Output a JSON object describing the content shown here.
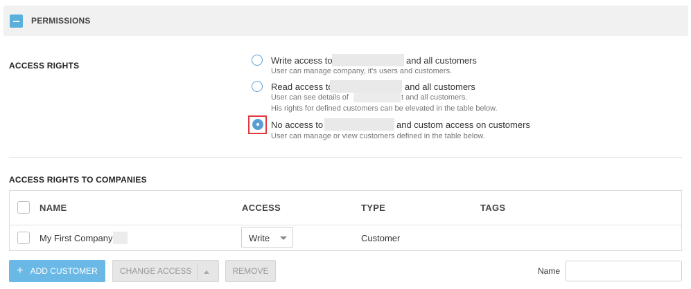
{
  "panel": {
    "title": "PERMISSIONS"
  },
  "access_rights": {
    "label": "ACCESS RIGHTS",
    "options": [
      {
        "pre": "Write access to",
        "post": "and all customers",
        "desc": "User can manage company, it's users and customers.",
        "checked": false
      },
      {
        "pre": "Read access to",
        "post": "and all customers",
        "desc_pre": "User can see details of",
        "desc_post": "t and all customers.",
        "desc2": "His rights for defined customers can be elevated in the table below.",
        "checked": false
      },
      {
        "pre": "No access to",
        "post": "and custom access on customers",
        "desc": "User can manage or view customers defined in the table below.",
        "checked": true
      }
    ]
  },
  "companies": {
    "label": "ACCESS RIGHTS TO COMPANIES",
    "columns": [
      "NAME",
      "ACCESS",
      "TYPE",
      "TAGS"
    ],
    "rows": [
      {
        "name": "My First Company",
        "access": "Write",
        "type": "Customer",
        "tags": ""
      }
    ]
  },
  "actions": {
    "add": "ADD CUSTOMER",
    "change": "CHANGE ACCESS",
    "remove": "REMOVE"
  },
  "filter": {
    "label": "Name",
    "value": ""
  },
  "colors": {
    "accent": "#5ab0db",
    "highlight": "#e0393e"
  }
}
